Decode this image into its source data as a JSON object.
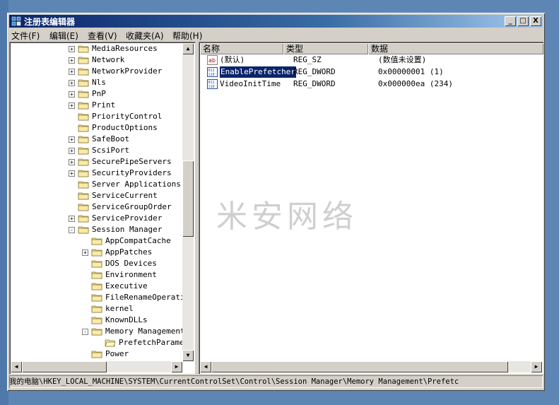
{
  "window": {
    "title": "注册表编辑器",
    "controls": [
      "_",
      "□",
      "X"
    ]
  },
  "menu": [
    "文件(F)",
    "编辑(E)",
    "查看(V)",
    "收藏夹(A)",
    "帮助(H)"
  ],
  "tree": [
    {
      "label": "MediaResources",
      "expand": "+",
      "level": 0
    },
    {
      "label": "Network",
      "expand": "+",
      "level": 0
    },
    {
      "label": "NetworkProvider",
      "expand": "+",
      "level": 0
    },
    {
      "label": "Nls",
      "expand": "+",
      "level": 0
    },
    {
      "label": "PnP",
      "expand": "+",
      "level": 0
    },
    {
      "label": "Print",
      "expand": "+",
      "level": 0
    },
    {
      "label": "PriorityControl",
      "expand": "",
      "level": 0
    },
    {
      "label": "ProductOptions",
      "expand": "",
      "level": 0
    },
    {
      "label": "SafeBoot",
      "expand": "+",
      "level": 0
    },
    {
      "label": "ScsiPort",
      "expand": "+",
      "level": 0
    },
    {
      "label": "SecurePipeServers",
      "expand": "+",
      "level": 0
    },
    {
      "label": "SecurityProviders",
      "expand": "+",
      "level": 0
    },
    {
      "label": "Server Applications",
      "expand": "",
      "level": 0
    },
    {
      "label": "ServiceCurrent",
      "expand": "",
      "level": 0
    },
    {
      "label": "ServiceGroupOrder",
      "expand": "",
      "level": 0
    },
    {
      "label": "ServiceProvider",
      "expand": "+",
      "level": 0
    },
    {
      "label": "Session Manager",
      "expand": "-",
      "level": 0
    },
    {
      "label": "AppCompatCache",
      "expand": "",
      "level": 1
    },
    {
      "label": "AppPatches",
      "expand": "+",
      "level": 1
    },
    {
      "label": "DOS Devices",
      "expand": "",
      "level": 1
    },
    {
      "label": "Environment",
      "expand": "",
      "level": 1
    },
    {
      "label": "Executive",
      "expand": "",
      "level": 1
    },
    {
      "label": "FileRenameOperatio",
      "expand": "",
      "level": 1
    },
    {
      "label": "kernel",
      "expand": "",
      "level": 1
    },
    {
      "label": "KnownDLLs",
      "expand": "",
      "level": 1
    },
    {
      "label": "Memory Management",
      "expand": "-",
      "level": 1
    },
    {
      "label": "PrefetchParamet",
      "expand": "",
      "level": 2,
      "open": true
    },
    {
      "label": "Power",
      "expand": "",
      "level": 1
    }
  ],
  "list": {
    "headers": [
      "名称",
      "类型",
      "数据"
    ],
    "rows": [
      {
        "icon": "string-value-icon",
        "name": "(默认)",
        "type": "REG_SZ",
        "data": "(数值未设置)",
        "selected": false
      },
      {
        "icon": "binary-value-icon",
        "name": "EnablePrefetcher",
        "type": "REG_DWORD",
        "data": "0x00000001 (1)",
        "selected": true
      },
      {
        "icon": "binary-value-icon",
        "name": "VideoInitTime",
        "type": "REG_DWORD",
        "data": "0x000000ea (234)",
        "selected": false
      }
    ]
  },
  "watermark": "米安网络",
  "status": "我的电脑\\HKEY_LOCAL_MACHINE\\SYSTEM\\CurrentControlSet\\Control\\Session Manager\\Memory Management\\Prefetc"
}
